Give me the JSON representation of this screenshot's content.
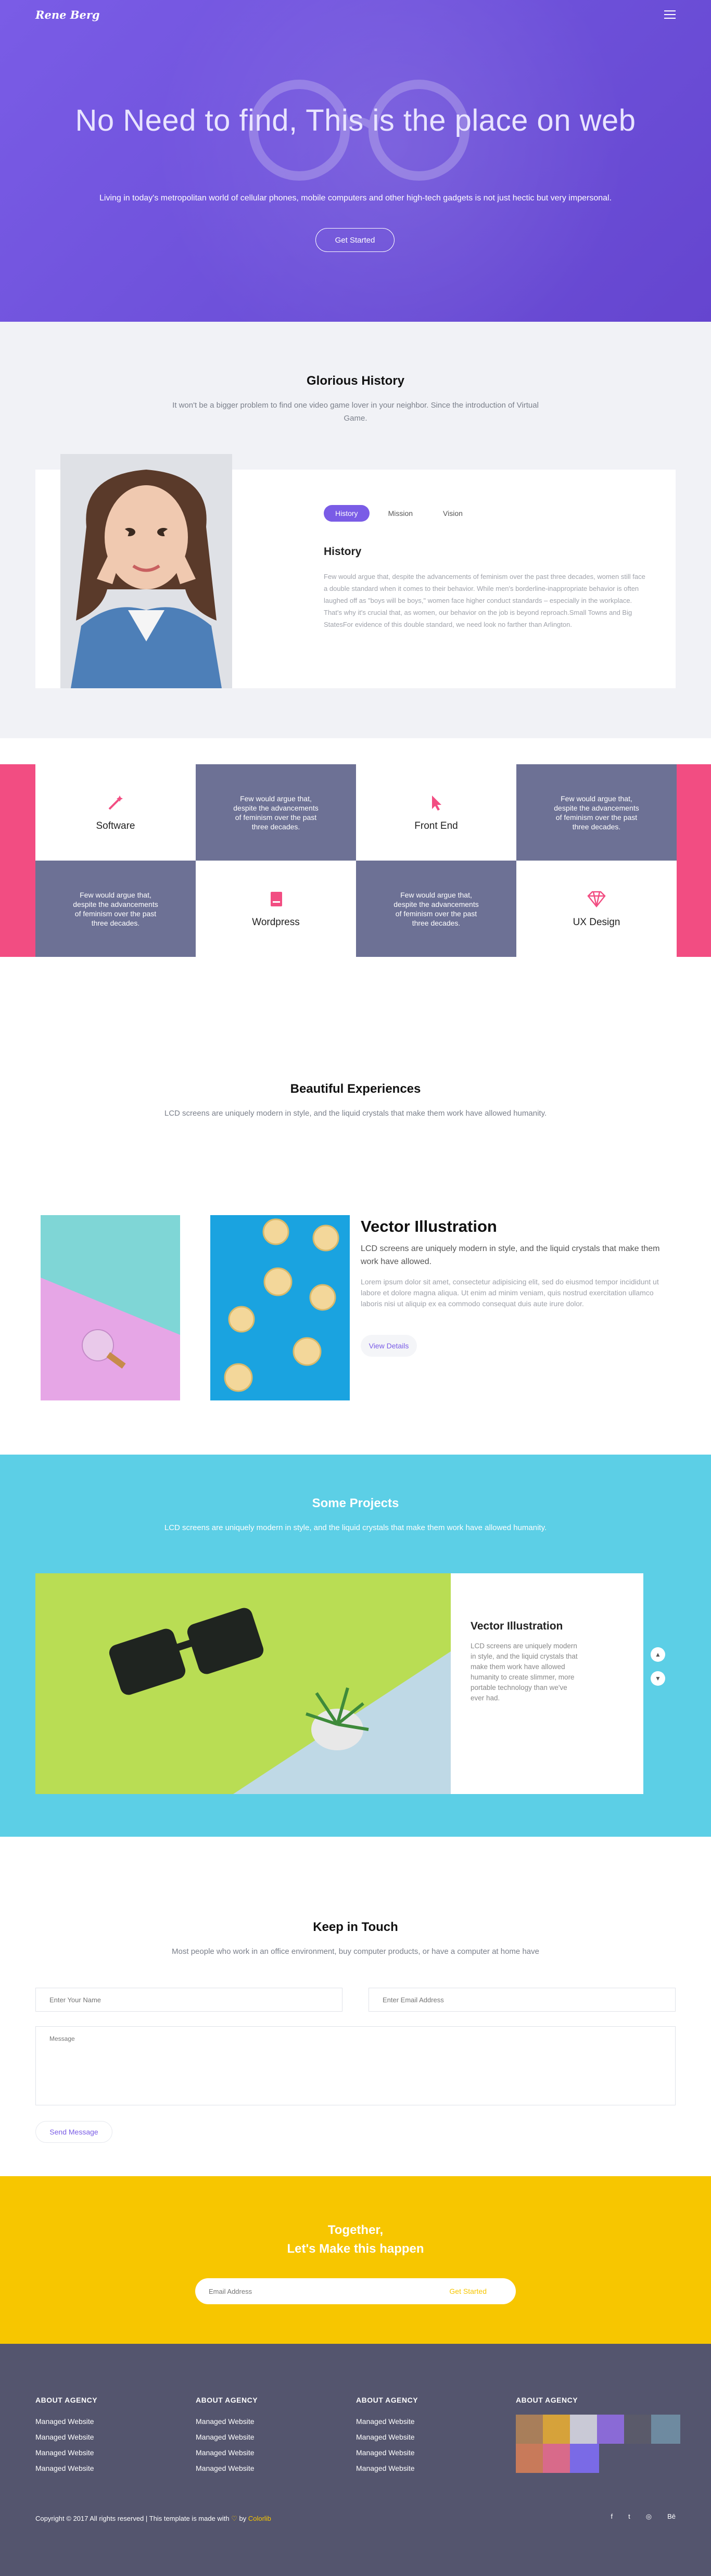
{
  "header": {
    "logo": "Rene Berg",
    "menu_icon": "hamburger-icon"
  },
  "hero": {
    "title": "No Need to find, This is the place on web",
    "subtitle": "Living in today's metropolitan world of cellular phones, mobile computers and other high-tech gadgets is not just hectic but very impersonal.",
    "button": "Get Started",
    "background_color": "#7a5ce6"
  },
  "history": {
    "title": "Glorious History",
    "subtitle": "It won't be a bigger problem to find one video game lover in your neighbor. Since the introduction of Virtual Game.",
    "tabs": [
      {
        "label": "History",
        "active": true
      },
      {
        "label": "Mission",
        "active": false
      },
      {
        "label": "Vision",
        "active": false
      }
    ],
    "heading": "History",
    "text": "Few would argue that, despite the advancements of feminism over the past three decades, women still face a double standard when it comes to their behavior. While men's borderline-inappropriate behavior is often laughed off as \"boys will be boys,\" women face higher conduct standards – especially in the workplace. That's why it's crucial that, as women, our behavior on the job is beyond reproach.Small Towns and Big StatesFor evidence of this double standard, we need look no farther than Arlington."
  },
  "services": {
    "accent_color": "#f24d82",
    "tiles": [
      {
        "type": "label",
        "label": "Software",
        "icon": "magic-wand-icon"
      },
      {
        "type": "text",
        "text": "Few would argue that, despite the advancements of feminism over the past three decades."
      },
      {
        "type": "label",
        "label": "Front End",
        "icon": "cursor-icon"
      },
      {
        "type": "text",
        "text": "Few would argue that, despite the advancements of feminism over the past three decades."
      },
      {
        "type": "text",
        "text": "Few would argue that, despite the advancements of feminism over the past three decades."
      },
      {
        "type": "label",
        "label": "Wordpress",
        "icon": "book-icon"
      },
      {
        "type": "text",
        "text": "Few would argue that, despite the advancements of feminism over the past three decades."
      },
      {
        "type": "label",
        "label": "UX Design",
        "icon": "diamond-icon"
      }
    ]
  },
  "experiences": {
    "title": "Beautiful Experiences",
    "subtitle": "LCD screens are uniquely modern in style, and the liquid crystals that make them work have allowed humanity.",
    "heading": "Vector Illustration",
    "text1": "LCD screens are uniquely modern in style, and the liquid crystals that make them work have allowed.",
    "text2": "Lorem ipsum dolor sit amet, consectetur adipisicing elit, sed do eiusmod tempor incididunt ut labore et dolore magna aliqua. Ut enim ad minim veniam, quis nostrud exercitation ullamco laboris nisi ut aliquip ex ea commodo consequat duis aute irure dolor.",
    "button": "View Details"
  },
  "projects": {
    "title": "Some Projects",
    "subtitle": "LCD screens are uniquely modern in style, and the liquid crystals that make them work have allowed humanity.",
    "card_title": "Vector Illustration",
    "card_text": "LCD screens are uniquely modern in style, and the liquid crystals that make them work have allowed humanity to create slimmer, more portable technology than we've ever had.",
    "background_color": "#5ccfe6"
  },
  "contact": {
    "title": "Keep in Touch",
    "subtitle": "Most people who work in an office environment, buy computer products, or have a computer at home have",
    "name_placeholder": "Enter Your Name",
    "email_placeholder": "Enter Email Address",
    "message_placeholder": "Message",
    "button": "Send Message"
  },
  "cta": {
    "line1": "Together,",
    "line2": "Let's Make this happen",
    "email_placeholder": "Email Address",
    "button": "Get Started",
    "background_color": "#f7c600"
  },
  "footer": {
    "columns": [
      {
        "title": "ABOUT AGENCY",
        "links": [
          "Managed Website",
          "Managed Website",
          "Managed Website",
          "Managed Website"
        ]
      },
      {
        "title": "ABOUT AGENCY",
        "links": [
          "Managed Website",
          "Managed Website",
          "Managed Website",
          "Managed Website"
        ]
      },
      {
        "title": "ABOUT AGENCY",
        "links": [
          "Managed Website",
          "Managed Website",
          "Managed Website",
          "Managed Website"
        ]
      }
    ],
    "instagram_title": "ABOUT AGENCY",
    "copyright": "Copyright © 2017 All rights reserved | This template is made with",
    "heart": "♡",
    "by": "by",
    "author": "Colorlib",
    "socials": [
      "facebook-icon",
      "twitter-icon",
      "dribbble-icon",
      "behance-icon"
    ],
    "background_color": "#54556e"
  }
}
